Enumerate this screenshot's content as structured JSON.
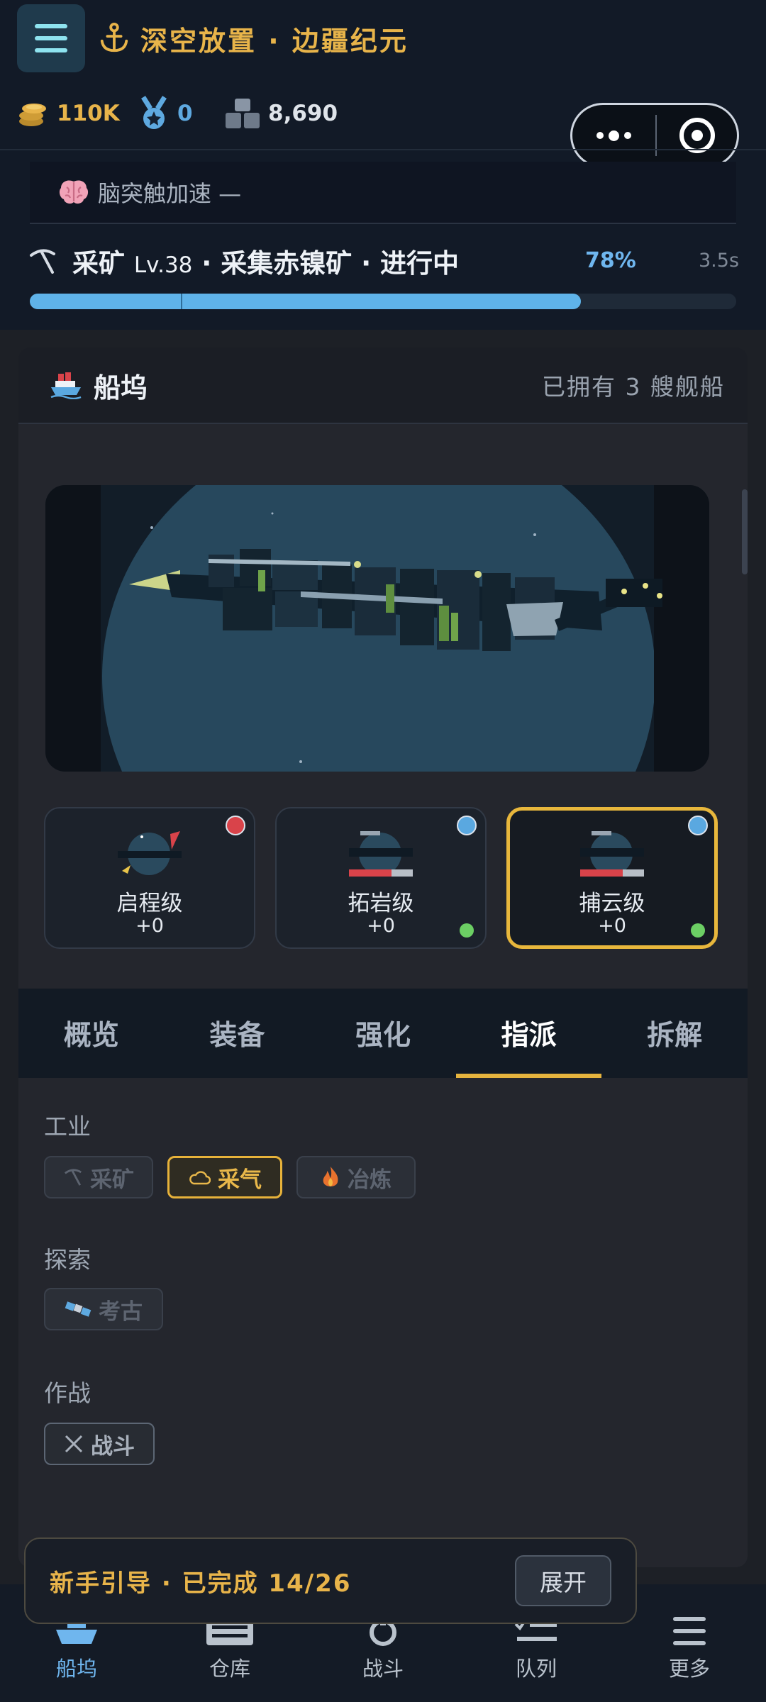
{
  "header": {
    "game_title": "深空放置 · 边疆纪元",
    "resources": [
      {
        "icon": "coin-stack-icon",
        "value": "110K",
        "color": "#e8b44a"
      },
      {
        "icon": "medal-icon",
        "value": "0",
        "color": "#5ea9e0"
      },
      {
        "icon": "crate-icon",
        "value": "8,690",
        "color": "#dfe4ea"
      }
    ]
  },
  "boost": {
    "icon": "brain-icon",
    "label": "脑突触加速 —"
  },
  "activity": {
    "icon": "pickaxe-icon",
    "skill": "采矿",
    "level": "Lv.38",
    "task": "· 采集赤镍矿 · 进行中",
    "percent_label": "78%",
    "progress": 0.78,
    "time": "3.5s"
  },
  "dock": {
    "icon": "ship-icon",
    "title": "船坞",
    "owned": "已拥有 3 艘舰船",
    "ships": [
      {
        "name": "启程级",
        "level": "+0",
        "tier_color": "#d9434a",
        "ready": false,
        "selected": false
      },
      {
        "name": "拓岩级",
        "level": "+0",
        "tier_color": "#5aa8e0",
        "ready": true,
        "selected": false
      },
      {
        "name": "捕云级",
        "level": "+0",
        "tier_color": "#5aa8e0",
        "ready": true,
        "selected": true
      }
    ]
  },
  "tabs": [
    {
      "label": "概览",
      "active": false
    },
    {
      "label": "装备",
      "active": false
    },
    {
      "label": "强化",
      "active": false
    },
    {
      "label": "指派",
      "active": true
    },
    {
      "label": "拆解",
      "active": false
    }
  ],
  "assign": {
    "industry": {
      "label": "工业",
      "options": [
        {
          "icon": "pickaxe-icon",
          "label": "采矿",
          "state": "disabled"
        },
        {
          "icon": "cloud-icon",
          "label": "采气",
          "state": "selected"
        },
        {
          "icon": "fire-icon",
          "label": "冶炼",
          "state": "disabled"
        }
      ]
    },
    "explore": {
      "label": "探索",
      "options": [
        {
          "icon": "satellite-icon",
          "label": "考古",
          "state": "disabled"
        }
      ]
    },
    "combat": {
      "label": "作战",
      "options": [
        {
          "icon": "crossed-swords-icon",
          "label": "战斗",
          "state": "enabled"
        }
      ]
    }
  },
  "guide": {
    "text": "新手引导 · 已完成 14/26",
    "button": "展开"
  },
  "nav": [
    {
      "label": "船坞",
      "icon": "ship-icon",
      "active": true
    },
    {
      "label": "仓库",
      "icon": "warehouse-icon",
      "active": false
    },
    {
      "label": "战斗",
      "icon": "combat-icon",
      "active": false
    },
    {
      "label": "队列",
      "icon": "queue-icon",
      "active": false
    },
    {
      "label": "更多",
      "icon": "menu-icon",
      "active": false
    }
  ]
}
